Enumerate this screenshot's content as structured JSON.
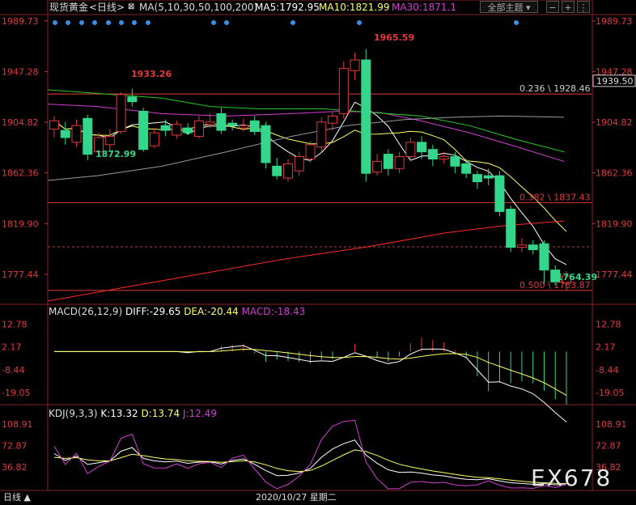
{
  "header": {
    "title": "现货黄金",
    "period": "<日线>",
    "ma_params": "MA(5,10,30,50,100,200)",
    "ma5": "MA5:1792.95",
    "ma10": "MA10:1821.99",
    "ma30": "MA30:1871.1",
    "theme_button": "全部主题"
  },
  "colors": {
    "up": "#e23a3a",
    "down": "#33d68a",
    "ma5": "#ffffff",
    "ma10": "#ffff66",
    "ma30": "#d040d0",
    "ma50": "#28c828",
    "ma100": "#9a9a9a",
    "ma200": "#ff2a2a",
    "fib": "#e23a3a"
  },
  "price_axis": [
    "1989.73",
    "1947.28",
    "1904.82",
    "1862.36",
    "1819.90",
    "1777.44"
  ],
  "price_annotations": {
    "high": "1965.59",
    "peak_left": "1933.26",
    "low_left": "1872.99",
    "low_right": "1764.39",
    "current": "1939.50"
  },
  "fib_levels": [
    {
      "label": "0.236 \\ 1928.46",
      "price": 1928.46
    },
    {
      "label": "0.382 \\ 1837.43",
      "price": 1837.43
    },
    {
      "label": "0.500 \\ 1763.87",
      "price": 1763.87
    }
  ],
  "macd": {
    "title": "MACD(26,12,9)",
    "diff": "DIFF:-29.65",
    "dea": "DEA:-20.44",
    "macd": "MACD:-18.43",
    "axis": [
      "12.78",
      "2.17",
      "-8.44",
      "-19.05"
    ]
  },
  "kdj": {
    "title": "KDJ(9,3,3)",
    "k": "K:13.32",
    "d": "D:13.74",
    "j": "J:12.49",
    "axis": [
      "108.91",
      "72.87",
      "36.82"
    ]
  },
  "footer": {
    "period": "日线 ▲",
    "date": "2020/10/27 星期二"
  },
  "watermark": "EX678",
  "chart_data": {
    "type": "candlestick",
    "ylim": [
      1755,
      1995
    ],
    "candles": [
      [
        1899,
        1906,
        1892,
        1910
      ],
      [
        1898,
        1892,
        1886,
        1905
      ],
      [
        1888,
        1902,
        1884,
        1907
      ],
      [
        1908,
        1878,
        1873,
        1911
      ],
      [
        1880,
        1892,
        1876,
        1896
      ],
      [
        1886,
        1893,
        1880,
        1899
      ],
      [
        1897,
        1928,
        1895,
        1930
      ],
      [
        1926,
        1922,
        1918,
        1933
      ],
      [
        1914,
        1882,
        1880,
        1917
      ],
      [
        1885,
        1896,
        1883,
        1900
      ],
      [
        1902,
        1898,
        1893,
        1907
      ],
      [
        1894,
        1903,
        1891,
        1906
      ],
      [
        1900,
        1896,
        1894,
        1904
      ],
      [
        1893,
        1906,
        1891,
        1910
      ],
      [
        1903,
        1905,
        1900,
        1912
      ],
      [
        1912,
        1898,
        1895,
        1917
      ],
      [
        1904,
        1902,
        1898,
        1907
      ],
      [
        1900,
        1902,
        1897,
        1908
      ],
      [
        1906,
        1897,
        1894,
        1910
      ],
      [
        1902,
        1871,
        1866,
        1905
      ],
      [
        1868,
        1860,
        1857,
        1875
      ],
      [
        1858,
        1870,
        1855,
        1874
      ],
      [
        1864,
        1876,
        1860,
        1880
      ],
      [
        1874,
        1886,
        1871,
        1889
      ],
      [
        1884,
        1905,
        1880,
        1909
      ],
      [
        1904,
        1910,
        1898,
        1913
      ],
      [
        1912,
        1950,
        1908,
        1956
      ],
      [
        1948,
        1957,
        1940,
        1963
      ],
      [
        1957,
        1862,
        1855,
        1966
      ],
      [
        1863,
        1872,
        1860,
        1878
      ],
      [
        1878,
        1866,
        1860,
        1882
      ],
      [
        1866,
        1876,
        1862,
        1880
      ],
      [
        1876,
        1888,
        1872,
        1892
      ],
      [
        1888,
        1880,
        1874,
        1893
      ],
      [
        1882,
        1874,
        1868,
        1886
      ],
      [
        1874,
        1876,
        1870,
        1880
      ],
      [
        1876,
        1868,
        1862,
        1880
      ],
      [
        1870,
        1862,
        1858,
        1874
      ],
      [
        1861,
        1855,
        1849,
        1864
      ],
      [
        1860,
        1858,
        1852,
        1866
      ],
      [
        1860,
        1830,
        1826,
        1864
      ],
      [
        1832,
        1800,
        1796,
        1835
      ],
      [
        1800,
        1802,
        1796,
        1808
      ],
      [
        1802,
        1798,
        1794,
        1806
      ],
      [
        1803,
        1781,
        1769,
        1806
      ],
      [
        1781,
        1771,
        1768,
        1785
      ],
      [
        1770,
        1776,
        1764,
        1780
      ]
    ]
  }
}
